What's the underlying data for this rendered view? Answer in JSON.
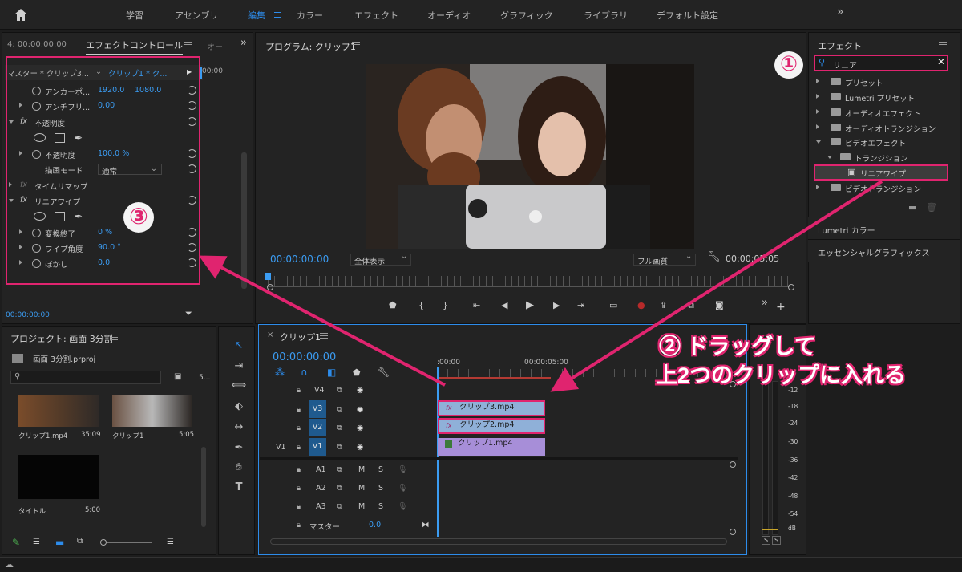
{
  "workspaces": [
    "学習",
    "アセンブリ",
    "編集",
    "カラー",
    "エフェクト",
    "オーディオ",
    "グラフィック",
    "ライブラリ",
    "デフォルト設定"
  ],
  "topbar_overflow": "»",
  "effect_controls": {
    "source_label": "4: 00:00:00:00",
    "title": "エフェクトコントロール",
    "next_tab": "オー",
    "overflow": "»",
    "master_label": "マスター * クリップ3...",
    "clip_label": "クリップ1 * ク...",
    "timeline_time": "00:00",
    "rows": [
      {
        "label": "アンカーポ...",
        "v1": "1920.0",
        "v2": "1080.0"
      },
      {
        "label": "アンチフリ...",
        "v1": "0.00"
      },
      {
        "label": "不透明度"
      },
      {
        "label": "不透明度",
        "v1": "100.0 %"
      },
      {
        "label": "描画モード",
        "v1": "通常"
      },
      {
        "label": "タイムリマップ"
      },
      {
        "label": "リニアワイプ"
      },
      {
        "label": "変換終了",
        "v1": "0 %"
      },
      {
        "label": "ワイプ角度",
        "v1": "90.0 °"
      },
      {
        "label": "ぼかし",
        "v1": "0.0"
      }
    ],
    "fx": "fx",
    "footer_time": "00:00:00:00"
  },
  "program": {
    "title": "プログラム: クリップ1",
    "timecode": "00:00:00:00",
    "zoom": "全体表示",
    "quality": "フル画質",
    "duration": "00:00:05:05",
    "controls": [
      "{",
      "}",
      "▶"
    ]
  },
  "effects_panel": {
    "title": "エフェクト",
    "search": "リニア",
    "tree": [
      {
        "label": "プリセット",
        "level": 0
      },
      {
        "label": "Lumetri プリセット",
        "level": 0
      },
      {
        "label": "オーディオエフェクト",
        "level": 0
      },
      {
        "label": "オーディオトランジション",
        "level": 0
      },
      {
        "label": "ビデオエフェクト",
        "level": 0
      },
      {
        "label": "トランジション",
        "level": 1
      },
      {
        "label": "リニアワイプ",
        "level": 2
      },
      {
        "label": "ビデオトランジション",
        "level": 0
      }
    ],
    "lumetri": "Lumetri カラー",
    "essential": "エッセンシャルグラフィックス"
  },
  "project": {
    "title": "プロジェクト: 画面 3分割",
    "file": "画面 3分割.prproj",
    "count": "5...",
    "items": [
      {
        "name": "クリップ1.mp4",
        "dur": "35:09"
      },
      {
        "name": "クリップ1",
        "dur": "5:05"
      },
      {
        "name": "タイトル",
        "dur": "5:00"
      }
    ]
  },
  "timeline": {
    "title": "クリップ1",
    "timecode": "00:00:00:00",
    "ruler": [
      ":00:00",
      "00:00:05:00"
    ],
    "video_tracks": [
      "V4",
      "V3",
      "V2",
      "V1"
    ],
    "source_v1": "V1",
    "audio_tracks": [
      "A1",
      "A2",
      "A3"
    ],
    "master": "マスター",
    "master_val": "0.0",
    "m": "M",
    "s": "S",
    "clips": [
      "クリップ3.mp4",
      "クリップ2.mp4",
      "クリップ1.mp4"
    ]
  },
  "meter": {
    "scale": [
      "-12",
      "-18",
      "-24",
      "-30",
      "-36",
      "-42",
      "-48",
      "-54",
      "dB"
    ],
    "solo": [
      "S",
      "S"
    ]
  },
  "annotations": {
    "one": "①",
    "two": "② ドラッグして",
    "two_line2": "上2つのクリップに入れる",
    "three": "③"
  },
  "colors": {
    "accent": "#2d8ceb",
    "annotation": "#e0246f",
    "clip_video": "#8fb0d8",
    "clip_v1": "#a78ed8"
  }
}
